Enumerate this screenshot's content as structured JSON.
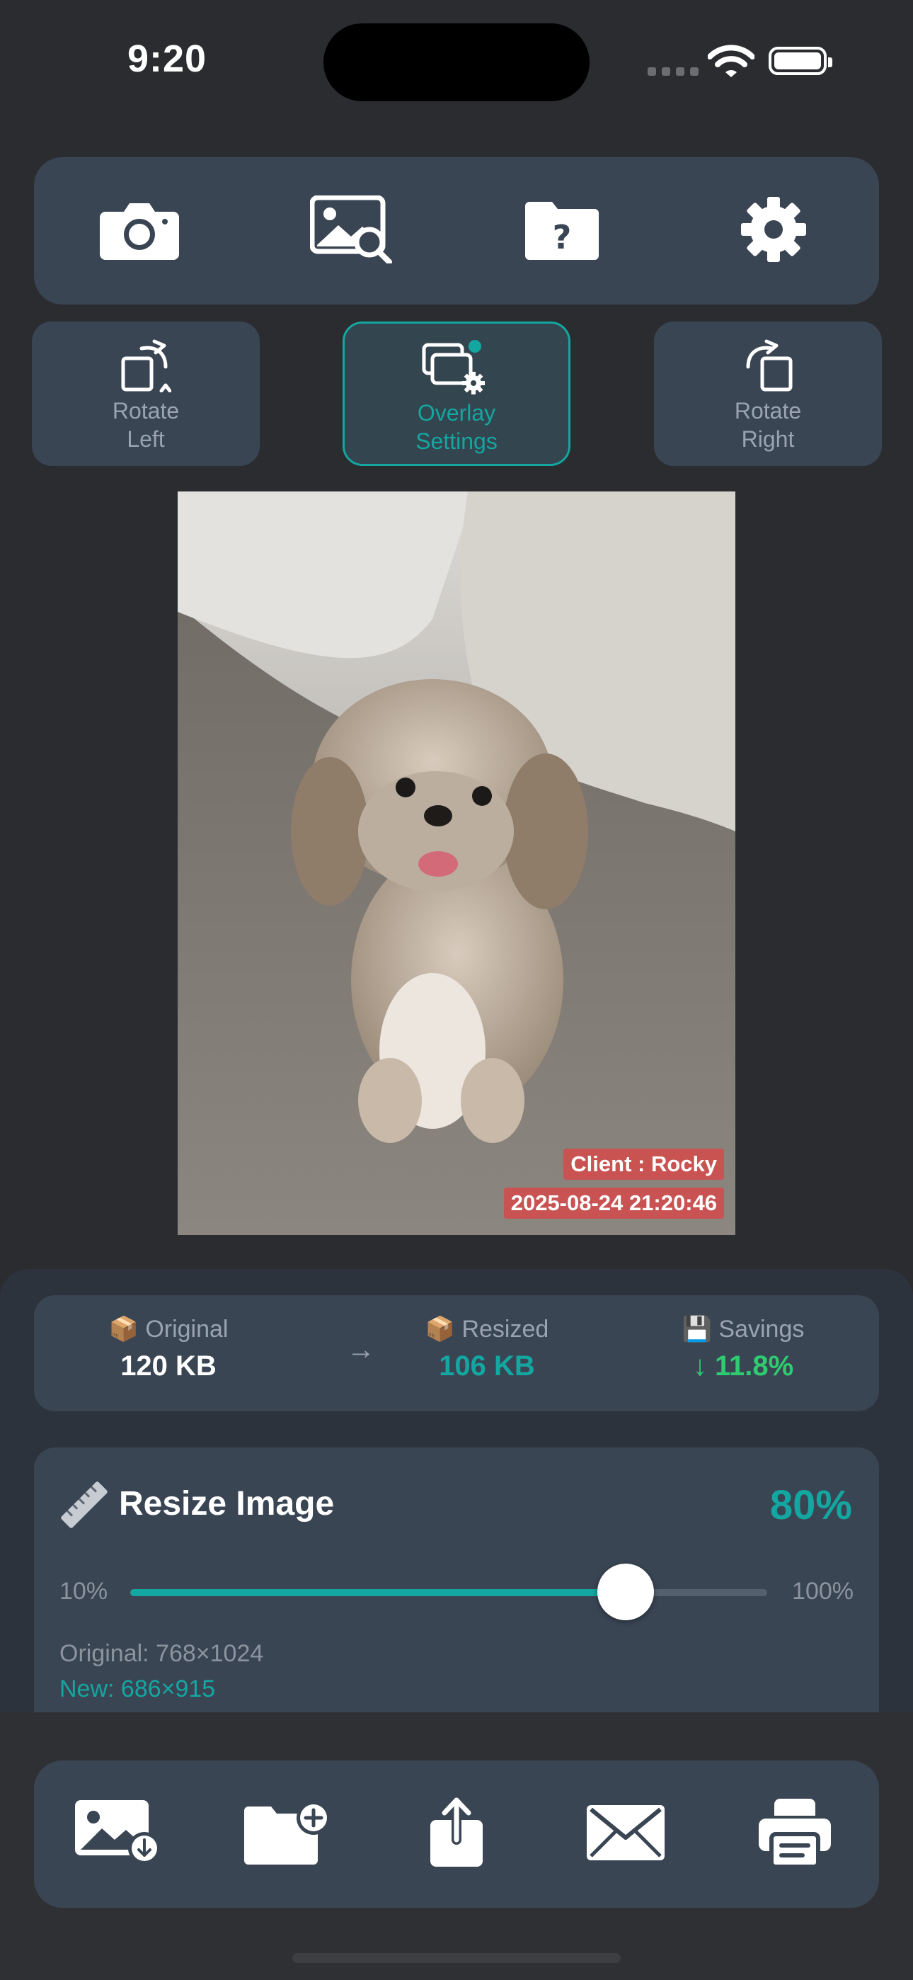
{
  "status_bar": {
    "time": "9:20"
  },
  "toolbar": {
    "items": [
      {
        "icon": "camera-icon"
      },
      {
        "icon": "image-search-icon"
      },
      {
        "icon": "folder-help-icon"
      },
      {
        "icon": "gear-icon"
      }
    ]
  },
  "actions": {
    "rotate_left": {
      "line1": "Rotate",
      "line2": "Left"
    },
    "overlay": {
      "line1": "Overlay",
      "line2": "Settings"
    },
    "rotate_right": {
      "line1": "Rotate",
      "line2": "Right"
    }
  },
  "photo": {
    "overlay_client": "Client : Rocky",
    "overlay_timestamp": "2025-08-24 21:20:46"
  },
  "stats": {
    "original": {
      "emoji": "📦",
      "label": "Original",
      "value": "120 KB"
    },
    "arrow": "→",
    "resized": {
      "emoji": "📦",
      "label": "Resized",
      "value": "106 KB"
    },
    "savings": {
      "emoji": "💾",
      "label": "Savings",
      "value": "↓ 11.8%"
    }
  },
  "resize": {
    "title": "Resize Image",
    "percent_label": "80%",
    "percent": 80,
    "min_label": "10%",
    "max_label": "100%",
    "min": 10,
    "max": 100,
    "original_dims": "Original: 768×1024",
    "new_dims": "New: 686×915"
  },
  "bottom_toolbar": {
    "items": [
      {
        "icon": "save-image-icon"
      },
      {
        "icon": "new-folder-icon"
      },
      {
        "icon": "share-icon"
      },
      {
        "icon": "mail-icon"
      },
      {
        "icon": "print-icon"
      }
    ]
  },
  "colors": {
    "accent": "#14a6a0",
    "savings_green": "#2ecc71",
    "panel": "#3a4554",
    "background": "#2a2c2f"
  }
}
